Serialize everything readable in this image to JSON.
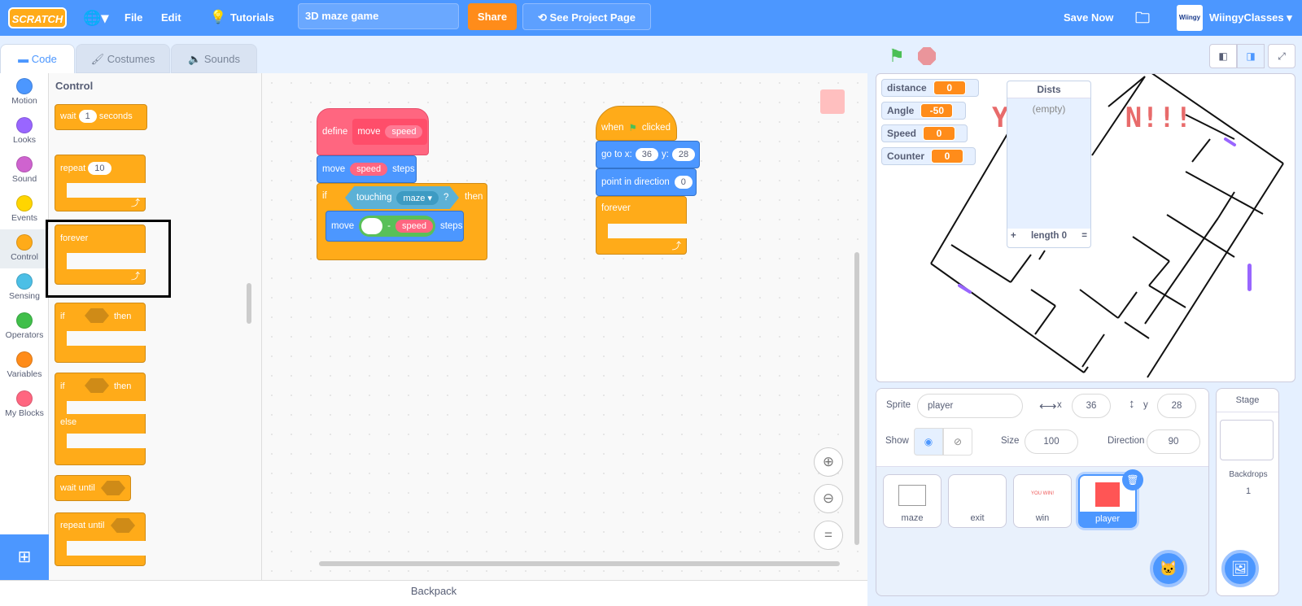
{
  "menubar": {
    "logo": "SCRATCH",
    "file": "File",
    "edit": "Edit",
    "tutorials": "Tutorials",
    "project_title": "3D maze game",
    "share": "Share",
    "see_project_page": "See Project Page",
    "save_now": "Save Now",
    "username": "WiingyClasses",
    "avatar_text": "Wiingy"
  },
  "tabs": {
    "code": "Code",
    "costumes": "Costumes",
    "sounds": "Sounds"
  },
  "categories": [
    {
      "label": "Motion",
      "color": "#4c97ff"
    },
    {
      "label": "Looks",
      "color": "#9966ff"
    },
    {
      "label": "Sound",
      "color": "#cf63cf"
    },
    {
      "label": "Events",
      "color": "#ffd500"
    },
    {
      "label": "Control",
      "color": "#ffab19"
    },
    {
      "label": "Sensing",
      "color": "#4cbfe6"
    },
    {
      "label": "Operators",
      "color": "#40bf4a"
    },
    {
      "label": "Variables",
      "color": "#ff8c1a"
    },
    {
      "label": "My Blocks",
      "color": "#ff6680"
    }
  ],
  "palette": {
    "heading": "Control",
    "wait": "wait",
    "wait_value": "1",
    "seconds": "seconds",
    "repeat": "repeat",
    "repeat_value": "10",
    "forever": "forever",
    "if": "if",
    "then": "then",
    "else": "else",
    "wait_until": "wait until",
    "repeat_until": "repeat until"
  },
  "scripts": {
    "define": "define",
    "move": "move",
    "speed": "speed",
    "steps": "steps",
    "if": "if",
    "touching": "touching",
    "maze": "maze",
    "q": "?",
    "then": "then",
    "minus": "-",
    "when": "when",
    "clicked": "clicked",
    "goto": "go to x:",
    "x": "36",
    "y_label": "y:",
    "y": "28",
    "point": "point in direction",
    "direction": "0",
    "forever": "forever"
  },
  "backpack": "Backpack",
  "stage": {
    "monitors": [
      {
        "label": "distance",
        "value": "0"
      },
      {
        "label": "Angle",
        "value": "-50"
      },
      {
        "label": "Speed",
        "value": "0"
      },
      {
        "label": "Counter",
        "value": "0"
      }
    ],
    "list": {
      "title": "Dists",
      "empty": "(empty)",
      "add": "+",
      "length": "length 0",
      "resize": "="
    }
  },
  "sprite_info": {
    "sprite_label": "Sprite",
    "sprite_name": "player",
    "x_label": "x",
    "x": "36",
    "y_label": "y",
    "y": "28",
    "show_label": "Show",
    "size_label": "Size",
    "size": "100",
    "direction_label": "Direction",
    "direction": "90"
  },
  "sprites": [
    {
      "name": "maze"
    },
    {
      "name": "exit"
    },
    {
      "name": "win",
      "thumb_text": "YOU WIN!"
    },
    {
      "name": "player",
      "selected": true
    }
  ],
  "stage_pane": {
    "title": "Stage",
    "backdrops_label": "Backdrops",
    "backdrops_count": "1"
  },
  "colors": {
    "accent": "#4c97ff",
    "control": "#ffab19",
    "motion": "#4c97ff",
    "myblocks": "#ff6680",
    "sensing": "#5cb1d6",
    "operators": "#59c059"
  }
}
